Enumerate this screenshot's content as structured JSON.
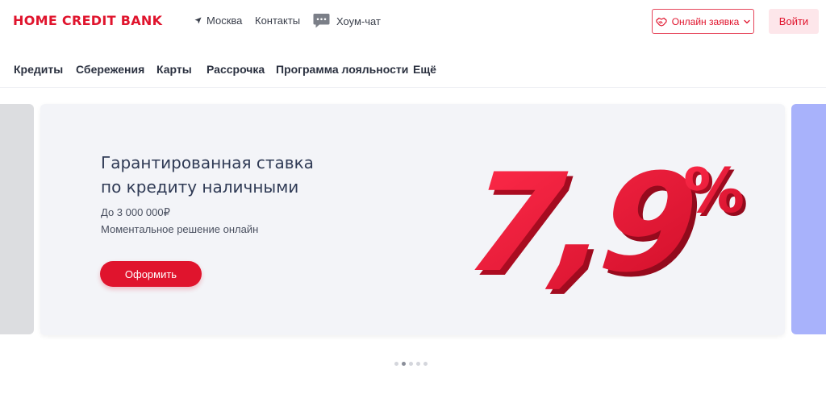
{
  "header": {
    "logo": "HOME CREDIT BANK",
    "city": "Москва",
    "contacts": "Контакты",
    "chat": "Хоум-чат",
    "apply_button": "Онлайн заявка",
    "login_button": "Войти"
  },
  "nav": {
    "items": [
      "Кредиты",
      "Сбережения",
      "Карты",
      "Рассрочка",
      "Программа лояльности",
      "Ещё"
    ]
  },
  "slide": {
    "title_line1": "Гарантированная ставка",
    "title_line2": "по кредиту наличными",
    "amount": "До 3 000 000₽",
    "decision": "Моментальное решение онлайн",
    "cta": "Оформить",
    "rate_value": "7,9",
    "rate_unit": "%"
  },
  "carousel": {
    "slides_count": 5,
    "active_index": 1
  },
  "colors": {
    "brand_red": "#e0142d",
    "next_slide": "#a8b2fb",
    "prev_slide": "#dcdde0"
  },
  "icons": {
    "city": "location-arrow-icon",
    "chat": "chat-bubble-icon",
    "apply": "handshake-icon",
    "dropdown": "chevron-down-icon"
  }
}
